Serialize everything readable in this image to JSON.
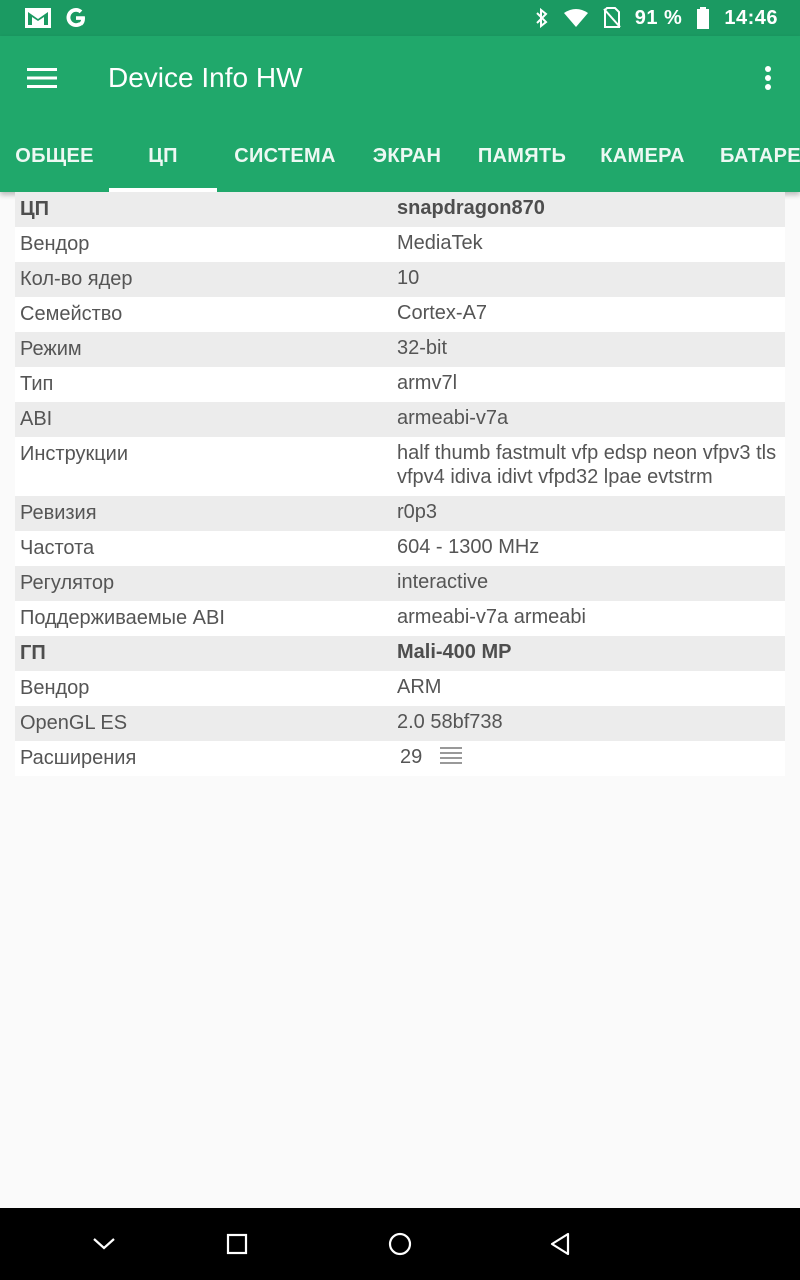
{
  "status_bar": {
    "battery_percent": "91 %",
    "time": "14:46",
    "icons": [
      "gmail-icon",
      "google-icon",
      "bluetooth-icon",
      "wifi-icon",
      "no-sim-icon",
      "battery-icon"
    ]
  },
  "app_bar": {
    "title": "Device Info HW",
    "icons": [
      "menu-icon",
      "more-vert-icon"
    ]
  },
  "tabs": [
    {
      "label": "ОБЩЕЕ"
    },
    {
      "label": "ЦП",
      "active": true
    },
    {
      "label": "СИСТЕМА"
    },
    {
      "label": "ЭКРАН"
    },
    {
      "label": "ПАМЯТЬ"
    },
    {
      "label": "КАМЕРА"
    },
    {
      "label": "БАТАРЕЯ"
    }
  ],
  "rows": [
    {
      "k": "ЦП",
      "v": "snapdragon870",
      "header": true
    },
    {
      "k": "Вендор",
      "v": "MediaTek"
    },
    {
      "k": "Кол-во ядер",
      "v": "10"
    },
    {
      "k": "Семейство",
      "v": "Cortex-A7"
    },
    {
      "k": "Режим",
      "v": "32-bit"
    },
    {
      "k": "Тип",
      "v": "armv7l"
    },
    {
      "k": "ABI",
      "v": "armeabi-v7a"
    },
    {
      "k": "Инструкции",
      "v": "half thumb fastmult vfp edsp neon vfpv3 tls vfpv4 idiva idivt vfpd32 lpae evtstrm"
    },
    {
      "k": "Ревизия",
      "v": "r0p3"
    },
    {
      "k": "Частота",
      "v": "604 - 1300 MHz"
    },
    {
      "k": "Регулятор",
      "v": "interactive"
    },
    {
      "k": "Поддерживаемые ABI",
      "v": "armeabi-v7a armeabi"
    },
    {
      "k": "ГП",
      "v": "Mali-400 MP",
      "header": true
    },
    {
      "k": "Вендор",
      "v": "ARM"
    },
    {
      "k": "OpenGL ES",
      "v": "2.0 58bf738"
    },
    {
      "k": "Расширения",
      "v": "29"
    }
  ],
  "nav_bar": {
    "icons": [
      "nav-down-icon",
      "recents-icon",
      "home-icon",
      "back-icon"
    ]
  }
}
